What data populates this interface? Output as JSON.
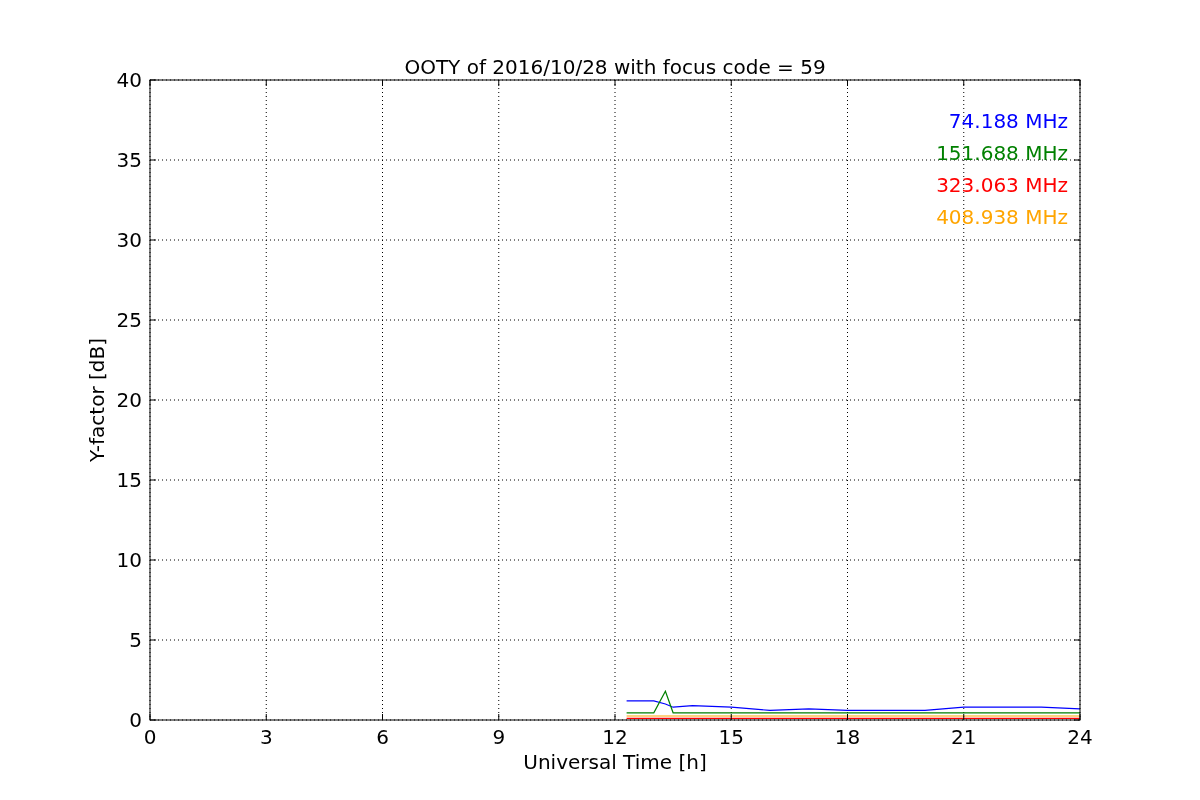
{
  "chart_data": {
    "type": "line",
    "title": "OOTY of 2016/10/28 with focus code = 59",
    "xlabel": "Universal Time [h]",
    "ylabel": "Y-factor [dB]",
    "x": [
      12.3,
      13,
      13.3,
      13.5,
      14,
      15,
      16,
      17,
      18,
      19,
      20,
      21,
      22,
      23,
      24
    ],
    "series": [
      {
        "name": "74.188 MHz",
        "color": "#0000ff",
        "values": [
          1.2,
          1.2,
          1.0,
          0.8,
          0.9,
          0.8,
          0.6,
          0.7,
          0.6,
          0.6,
          0.6,
          0.8,
          0.8,
          0.8,
          0.7
        ]
      },
      {
        "name": "151.688 MHz",
        "color": "#008000",
        "values": [
          0.45,
          0.45,
          1.8,
          0.45,
          0.45,
          0.45,
          0.45,
          0.45,
          0.45,
          0.45,
          0.45,
          0.45,
          0.45,
          0.45,
          0.45
        ]
      },
      {
        "name": "323.063 MHz",
        "color": "#ff0000",
        "values": [
          0.1,
          0.1,
          0.1,
          0.1,
          0.1,
          0.1,
          0.1,
          0.1,
          0.1,
          0.1,
          0.1,
          0.1,
          0.1,
          0.1,
          0.1
        ]
      },
      {
        "name": "408.938 MHz",
        "color": "#ffa500",
        "values": [
          0.25,
          0.25,
          0.25,
          0.25,
          0.25,
          0.25,
          0.25,
          0.25,
          0.25,
          0.25,
          0.25,
          0.25,
          0.25,
          0.25,
          0.25
        ]
      }
    ],
    "grid": true,
    "xlim": [
      0,
      24
    ],
    "ylim": [
      0,
      40
    ],
    "xticks": [
      0,
      3,
      6,
      9,
      12,
      15,
      18,
      21,
      24
    ],
    "yticks": [
      0,
      5,
      10,
      15,
      20,
      25,
      30,
      35,
      40
    ]
  }
}
